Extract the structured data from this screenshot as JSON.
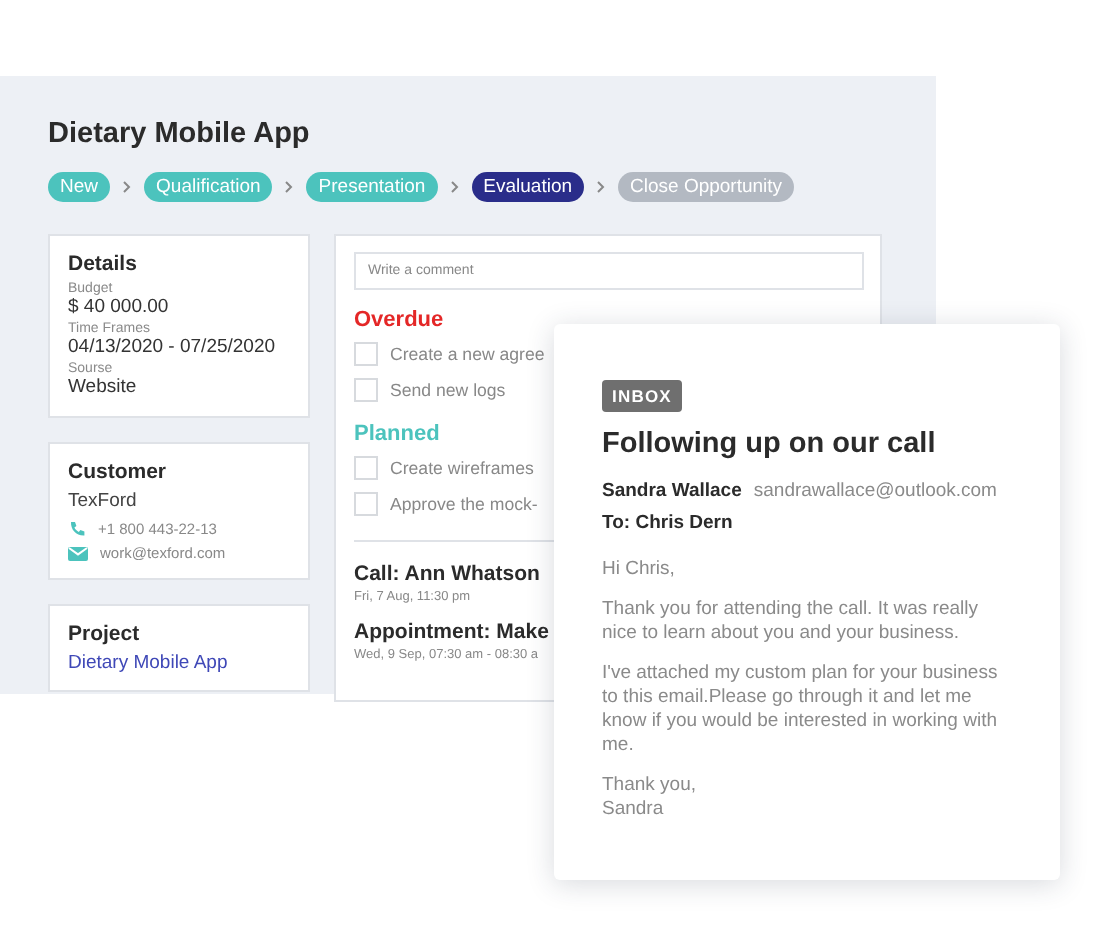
{
  "title": "Dietary Mobile App",
  "stages": [
    {
      "label": "New",
      "completed": true,
      "selected": false
    },
    {
      "label": "Qualification",
      "completed": true,
      "selected": false
    },
    {
      "label": "Presentation",
      "completed": true,
      "selected": false
    },
    {
      "label": "Evaluation",
      "completed": false,
      "selected": true
    },
    {
      "label": "Close Opportunity",
      "completed": false,
      "selected": false
    }
  ],
  "details": {
    "heading": "Details",
    "fields": [
      {
        "label": "Budget",
        "value": "$ 40 000.00"
      },
      {
        "label": "Time Frames",
        "value": "04/13/2020 - 07/25/2020"
      },
      {
        "label": "Sourse",
        "value": "Website"
      }
    ]
  },
  "customer": {
    "heading": "Customer",
    "name": "TexFord",
    "contacts": [
      {
        "kind": "phone",
        "text": "+1 800 443-22-13"
      },
      {
        "kind": "email",
        "text": "work@texford.com"
      }
    ]
  },
  "project": {
    "heading": "Project",
    "link": "Dietary Mobile App"
  },
  "comment": {
    "placeholder": "Write a comment"
  },
  "task_groups": [
    {
      "heading": "Overdue",
      "kind": "overdue",
      "tasks": [
        {
          "text": "Create a new agree",
          "checked": false
        },
        {
          "text": "Send new logs",
          "checked": false
        }
      ]
    },
    {
      "heading": "Planned",
      "kind": "planned",
      "tasks": [
        {
          "text": "Create wireframes",
          "checked": false
        },
        {
          "text": "Approve the mock-",
          "checked": false
        }
      ]
    }
  ],
  "events": [
    {
      "title": "Call: Ann Whatson",
      "time": "Fri, 7 Aug, 11:30 pm"
    },
    {
      "title": "Appointment: Make",
      "time": "Wed, 9 Sep, 07:30 am - 08:30 a"
    }
  ],
  "email": {
    "badge": "INBOX",
    "subject": "Following up on our call",
    "sender": "Sandra Wallace",
    "sender_email": "sandrawallace@outlook.com",
    "to": "To: Chris Dern",
    "paragraphs": [
      "Hi Chris,",
      "Thank you for attending the call. It was really nice to learn about you and your business.",
      "I've attached my custom plan for your business to this email.Please go through it and let me know if you would be interested in working with me.",
      "Thank you,\nSandra"
    ]
  }
}
